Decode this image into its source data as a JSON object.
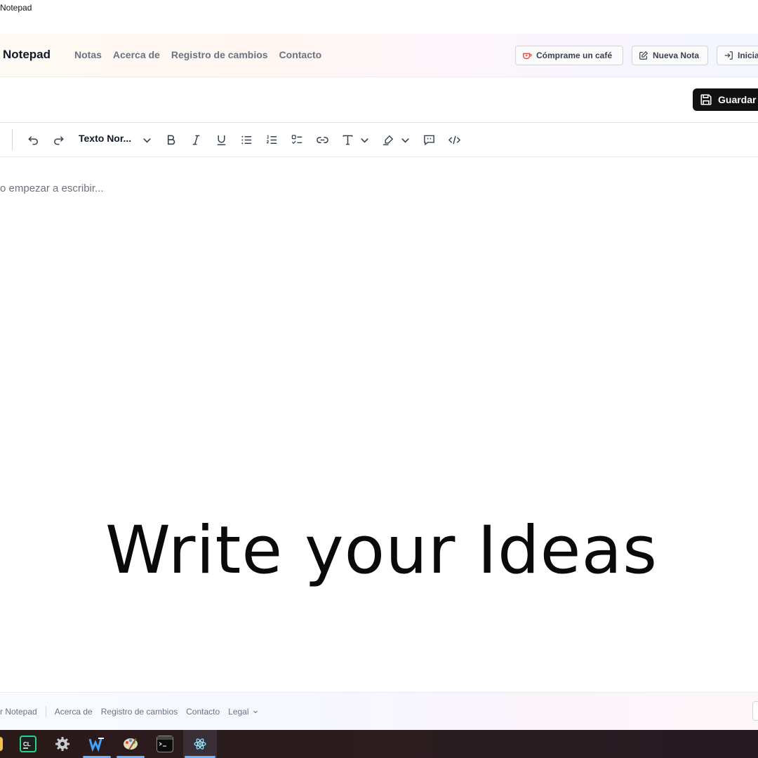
{
  "window": {
    "title": "Notepad"
  },
  "header": {
    "brand": "Notepad",
    "nav": [
      "Notas",
      "Acerca de",
      "Registro de cambios",
      "Contacto"
    ],
    "coffee_button": "Cómprame un café",
    "new_note_button": "Nueva Nota",
    "login_button": "Inicia"
  },
  "savebar": {
    "save_button": "Guardar"
  },
  "toolbar": {
    "block_type": "Texto Nor...",
    "icons": [
      "undo-icon",
      "redo-icon",
      "chevron-down-icon",
      "bold-icon",
      "italic-icon",
      "underline-icon",
      "bullet-list-icon",
      "ordered-list-icon",
      "checklist-icon",
      "link-icon",
      "text-format-icon",
      "highlight-icon",
      "comment-icon",
      "code-icon"
    ]
  },
  "editor": {
    "placeholder": "o empezar a escribir...",
    "hero_text": "Write your Ideas"
  },
  "footer": {
    "brand": "r Notepad",
    "links": [
      "Acerca de",
      "Registro de cambios",
      "Contacto",
      "Legal"
    ]
  },
  "taskbar": {
    "apps": [
      "clion-icon",
      "settings-icon",
      "wps-icon",
      "paint-icon",
      "terminal-icon",
      "electron-icon"
    ]
  }
}
